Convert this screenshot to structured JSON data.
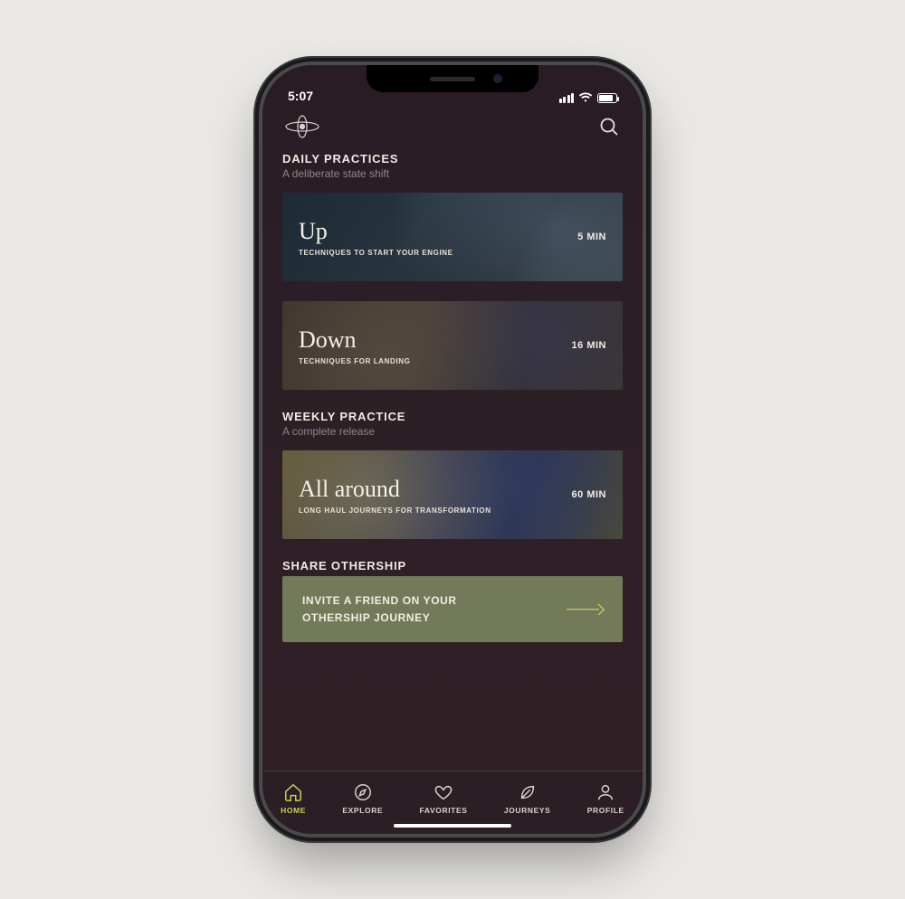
{
  "status": {
    "time": "5:07"
  },
  "sections": {
    "daily": {
      "title": "DAILY PRACTICES",
      "subtitle": "A deliberate state shift"
    },
    "weekly": {
      "title": "WEEKLY PRACTICE",
      "subtitle": "A complete release"
    },
    "share": {
      "title": "SHARE OTHERSHIP"
    }
  },
  "cards": {
    "up": {
      "title": "Up",
      "desc": "TECHNIQUES TO START YOUR ENGINE",
      "duration": "5 MIN"
    },
    "down": {
      "title": "Down",
      "desc": "TECHNIQUES FOR LANDING",
      "duration": "16 MIN"
    },
    "all": {
      "title": "All around",
      "desc": "LONG HAUL JOURNEYS FOR TRANSFORMATION",
      "duration": "60 MIN"
    }
  },
  "invite": {
    "text": "INVITE A FRIEND ON YOUR OTHERSHIP JOURNEY"
  },
  "tabs": {
    "home": "HOME",
    "explore": "EXPLORE",
    "favorites": "FAVORITES",
    "journeys": "JOURNEYS",
    "profile": "PROFILE"
  },
  "colors": {
    "accent": "#c9cf58",
    "background": "#2c1e25",
    "invite_bg": "#737a5a"
  }
}
